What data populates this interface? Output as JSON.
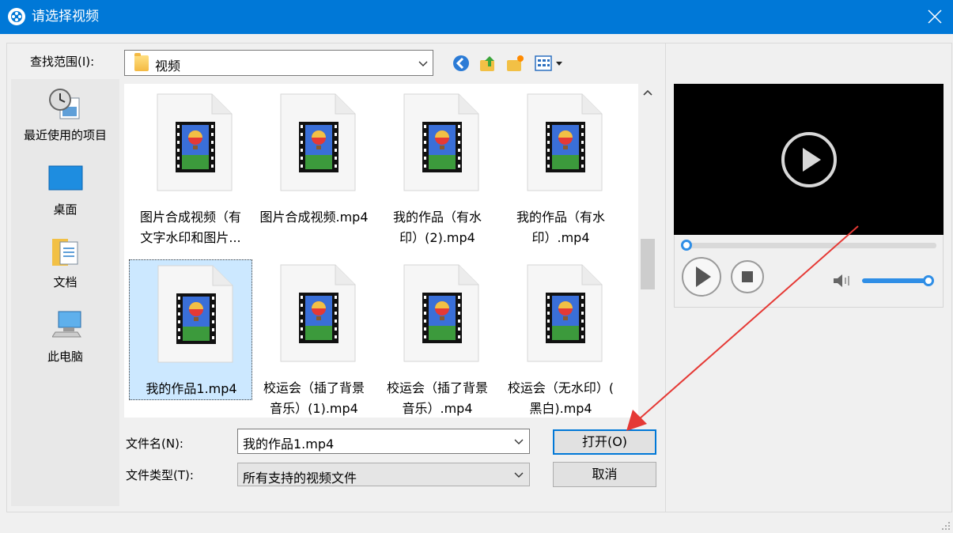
{
  "window": {
    "title": "请选择视频",
    "app_icon": "film-reel-icon",
    "close_icon": "close-icon"
  },
  "lookin": {
    "label": "查找范围(I):",
    "value": "视频"
  },
  "toolbar": {
    "icons": [
      "back-icon",
      "up-folder-icon",
      "new-folder-icon",
      "view-menu-icon"
    ]
  },
  "places": [
    {
      "label": "最近使用的项目",
      "icon": "recent-items-icon"
    },
    {
      "label": "桌面",
      "icon": "desktop-icon"
    },
    {
      "label": "文档",
      "icon": "documents-icon"
    },
    {
      "label": "此电脑",
      "icon": "computer-icon"
    }
  ],
  "files": [
    {
      "line1": "图片合成视频（有",
      "line2": "文字水印和图片..."
    },
    {
      "line1": "图片合成视频.mp4",
      "line2": ""
    },
    {
      "line1": "我的作品（有水",
      "line2": "印）(2).mp4"
    },
    {
      "line1": "我的作品（有水",
      "line2": "印）.mp4"
    },
    {
      "line1": "我的作品1.mp4",
      "line2": ""
    },
    {
      "line1": "校运会（插了背景",
      "line2": "音乐）(1).mp4"
    },
    {
      "line1": "校运会（插了背景",
      "line2": "音乐）.mp4"
    },
    {
      "line1": "校运会（无水印）(",
      "line2": "黑白).mp4"
    }
  ],
  "selected_file_index": 4,
  "filename": {
    "label": "文件名(N):",
    "value": "我的作品1.mp4"
  },
  "filetype": {
    "label": "文件类型(T):",
    "value": "所有支持的视频文件"
  },
  "buttons": {
    "open": "打开(O)",
    "cancel": "取消"
  },
  "player": {
    "seek_position": 0.0,
    "volume": 1.0
  },
  "colors": {
    "titlebar": "#0078d7",
    "accent": "#2f8ee6",
    "selection": "#cce8ff",
    "arrow": "#e53935"
  }
}
